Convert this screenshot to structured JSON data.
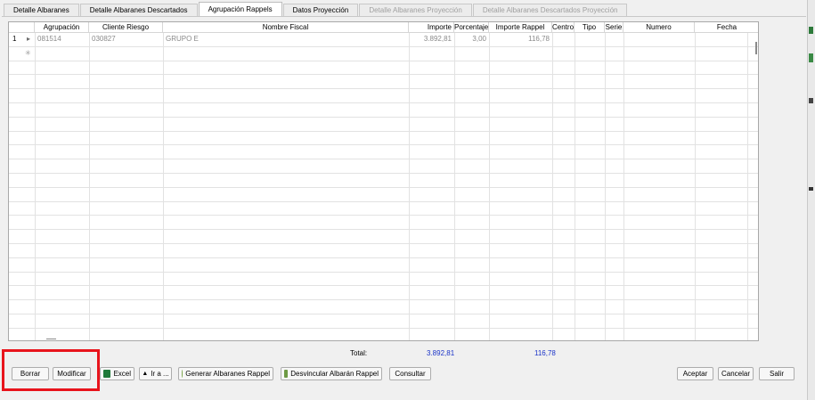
{
  "tabs": [
    {
      "label": "Detalle Albaranes",
      "state": "normal"
    },
    {
      "label": "Detalle Albaranes Descartados",
      "state": "normal"
    },
    {
      "label": "Agrupación Rappels",
      "state": "active"
    },
    {
      "label": "Datos Proyección",
      "state": "normal"
    },
    {
      "label": "Detalle Albaranes Proyección",
      "state": "disabled"
    },
    {
      "label": "Detalle Albaranes Descartados Proyección",
      "state": "disabled"
    }
  ],
  "grid": {
    "columns": [
      "Agrupación",
      "Cliente Riesgo",
      "Nombre Fiscal",
      "Importe",
      "Porcentaje",
      "Importe Rappel",
      "Centro",
      "Tipo",
      "Serie",
      "Numero",
      "Fecha"
    ],
    "rows": [
      {
        "row_number": "1",
        "agrupacion": "081514",
        "cliente_riesgo": "030827",
        "nombre_fiscal": "GRUPO E",
        "importe": "3.892,81",
        "porcentaje": "3,00",
        "importe_rappel": "116,78",
        "centro": "",
        "tipo": "",
        "serie": "",
        "numero": "",
        "fecha": ""
      }
    ],
    "new_row_marker": "✳"
  },
  "totals": {
    "label": "Total:",
    "importe": "3.892,81",
    "importe_rappel": "116,78"
  },
  "buttons": {
    "borrar": "Borrar",
    "modificar": "Modificar",
    "excel": "Excel",
    "ir_a": "Ir a ...",
    "generar": "Generar Albaranes Rappel",
    "desvincular": "Desvincular Albarán Rappel",
    "consultar": "Consultar",
    "aceptar": "Aceptar",
    "cancelar": "Cancelar",
    "salir": "Salir"
  },
  "colors": {
    "totals_text": "#1a33c8",
    "highlight_frame": "#e8141c"
  }
}
